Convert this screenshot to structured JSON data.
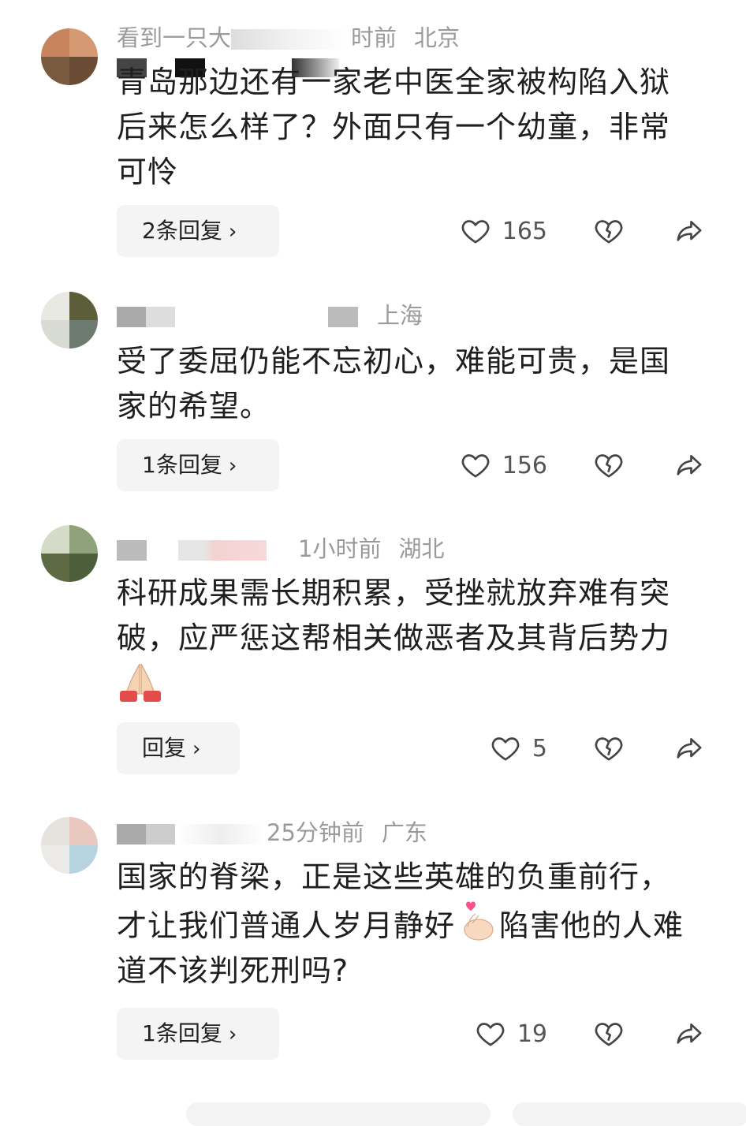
{
  "comments": [
    {
      "username": "看到一只大",
      "time": "时前",
      "location": "北京",
      "text": "青岛那边还有一家老中医全家被构陷入狱后来怎么样了？外面只有一个幼童，非常可怜",
      "reply_label": "2条回复",
      "likes": "165",
      "avatar_colors": [
        "#c9845e",
        "#d69a73",
        "#7a5a3e",
        "#6a4c35"
      ]
    },
    {
      "username": "",
      "time": "",
      "location": "上海",
      "text": "受了委屈仍能不忘初心，难能可贵，是国家的希望。",
      "reply_label": "1条回复",
      "likes": "156",
      "avatar_colors": [
        "#e9e9e4",
        "#5b5e38",
        "#d7dbd4",
        "#6c7a70"
      ]
    },
    {
      "username": "",
      "time": "1小时前",
      "location": "湖北",
      "text": "科研成果需长期积累，受挫就放弃难有突破，应严惩这帮相关做恶者及其背后势力",
      "reply_label": "回复",
      "likes": "5",
      "avatar_colors": [
        "#d4dcc9",
        "#8fa27a",
        "#5d6b45",
        "#4d5f3a"
      ]
    },
    {
      "username": "",
      "time": "25分钟前",
      "location": "广东",
      "text_part1": "国家的脊梁，正是这些英雄的负重前行，才让我们普通人岁月静好",
      "text_part2": "陷害他的人难道不该判死刑吗?",
      "reply_label": "1条回复",
      "likes": "19",
      "avatar_colors": [
        "#e6e2de",
        "#e8c8bf",
        "#eceae6",
        "#b6d4df"
      ]
    }
  ],
  "emojis": {
    "pray": "pray-hands-icon",
    "heart_hand": "finger-heart-icon"
  },
  "colors": {
    "text": "#1f1f1f",
    "meta": "#9a9a9a",
    "reply_bg": "#f4f4f4",
    "icon": "#444444"
  }
}
